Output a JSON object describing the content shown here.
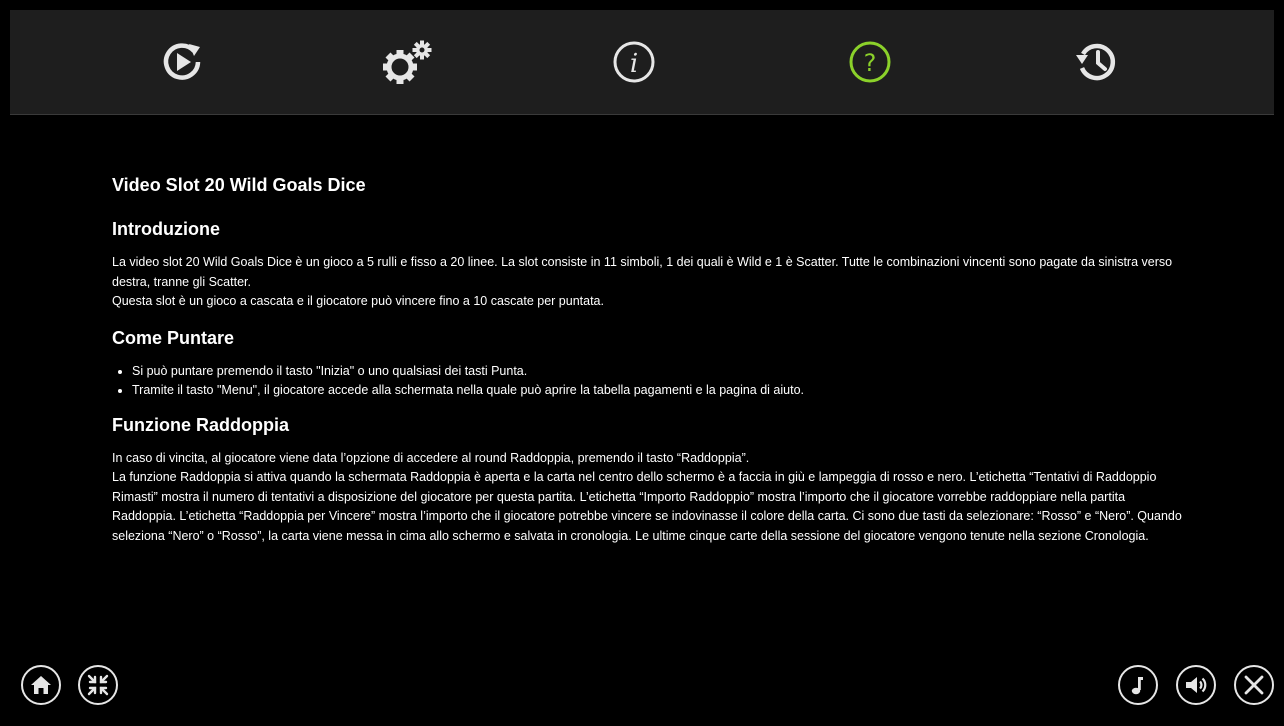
{
  "topbar": {
    "tabs": [
      {
        "icon": "autoplay-icon",
        "label": "autoplay"
      },
      {
        "icon": "settings-gears-icon",
        "label": "settings"
      },
      {
        "icon": "info-icon",
        "label": "info"
      },
      {
        "icon": "help-icon",
        "label": "help",
        "active": true
      },
      {
        "icon": "history-icon",
        "label": "history"
      }
    ],
    "accent_color": "#8bd12a"
  },
  "help": {
    "title": "Video Slot 20 Wild Goals Dice",
    "intro": {
      "heading": "Introduzione",
      "p1": "La video slot 20 Wild Goals Dice è un gioco a 5 rulli e fisso a 20 linee. La slot consiste in 11 simboli, 1 dei quali è Wild e 1 è Scatter. Tutte le combinazioni vincenti sono pagate da sinistra verso destra, tranne gli Scatter.",
      "p2": "Questa slot è un gioco a cascata e il giocatore può vincere fino a 10 cascate per puntata."
    },
    "bet": {
      "heading": "Come Puntare",
      "items": [
        "Si può puntare premendo il tasto \"Inizia\" o uno qualsiasi dei tasti Punta.",
        "Tramite il tasto \"Menu\", il giocatore accede alla schermata nella quale può aprire la tabella pagamenti e la pagina di aiuto."
      ]
    },
    "double": {
      "heading": "Funzione Raddoppia",
      "p1": "In caso di vincita, al giocatore viene data l’opzione di accedere al round Raddoppia, premendo il tasto “Raddoppia”.",
      "p2": "La funzione Raddoppia si attiva quando la schermata Raddoppia è aperta e la carta nel centro dello schermo è a faccia in giù e lampeggia di rosso e nero. L’etichetta “Tentativi di Raddoppio Rimasti” mostra il numero di tentativi a disposizione del giocatore per questa partita. L’etichetta “Importo Raddoppio” mostra l’importo che il giocatore vorrebbe raddoppiare nella partita Raddoppia. L’etichetta “Raddoppia per Vincere” mostra l’importo che il giocatore potrebbe vincere se indovinasse il colore della carta. Ci sono due tasti da selezionare: “Rosso” e “Nero”. Quando seleziona “Nero” o “Rosso”, la carta viene messa in cima allo schermo e salvata in cronologia. Le ultime cinque carte della sessione del giocatore vengono tenute nella sezione Cronologia."
    }
  },
  "bottom_controls": {
    "left": [
      "home-icon",
      "collapse-icon"
    ],
    "right": [
      "music-icon",
      "sound-icon",
      "close-icon"
    ]
  }
}
